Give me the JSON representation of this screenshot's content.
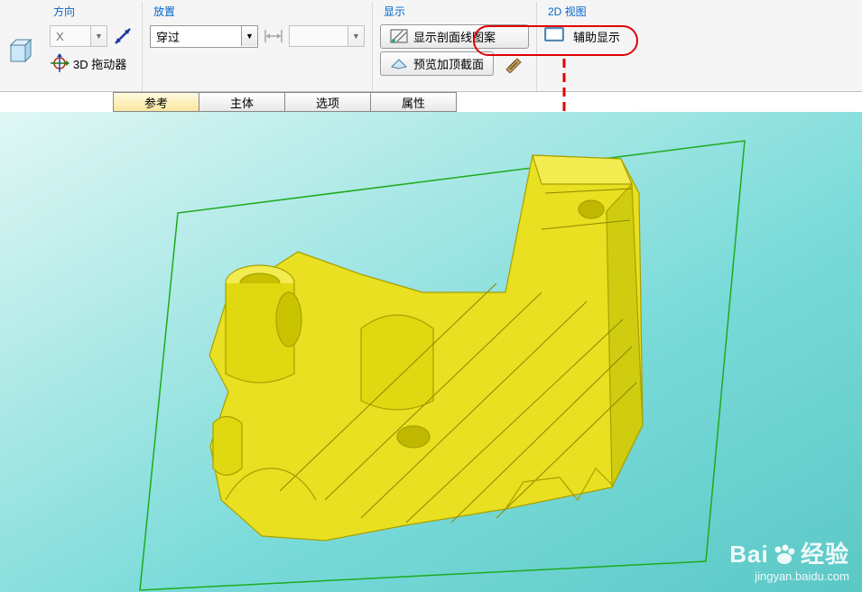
{
  "ribbon": {
    "direction": {
      "header": "方向",
      "x_label": "X",
      "dragger": "3D 拖动器"
    },
    "placement": {
      "header": "放置",
      "through": "穿过"
    },
    "display": {
      "header": "显示",
      "show_hatch": "显示剖面线图案",
      "preview_top": "预览加顶截面"
    },
    "view2d": {
      "header": "2D 视图",
      "aux_display": "辅助显示"
    }
  },
  "tabs": {
    "reference": "参考",
    "body": "主体",
    "options": "选项",
    "properties": "属性"
  },
  "watermark": {
    "brand": "Bai",
    "brand2": "经验",
    "url": "jingyan.baidu.com"
  }
}
